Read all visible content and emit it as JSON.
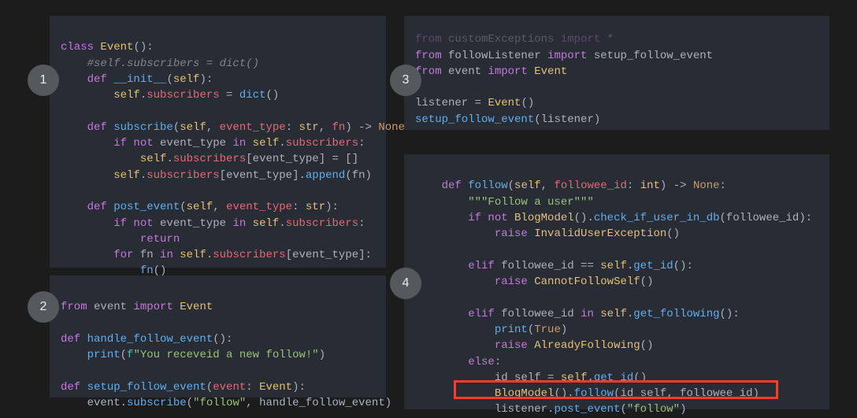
{
  "badges": {
    "b1": "1",
    "b2": "2",
    "b3": "3",
    "b4": "4"
  },
  "panel1": {
    "l1": {
      "a": "class ",
      "b": "Event",
      "c": "():"
    },
    "l2": {
      "a": "    #self.subscribers = dict()"
    },
    "l3": {
      "a": "    ",
      "b": "def ",
      "c": "__init__",
      "d": "(",
      "e": "self",
      "f": "):"
    },
    "l4": {
      "a": "        ",
      "b": "self",
      "c": ".",
      "d": "subscribers",
      "e": " = ",
      "f": "dict",
      "g": "()"
    },
    "l5": "",
    "l6": {
      "a": "    ",
      "b": "def ",
      "c": "subscribe",
      "d": "(",
      "e": "self",
      "f": ", ",
      "g": "event_type",
      "h": ": ",
      "i": "str",
      "j": ", ",
      "k": "fn",
      "l": ") -> ",
      "m": "None",
      "n": ":"
    },
    "l7": {
      "a": "        ",
      "b": "if not ",
      "c": "event_type",
      "d": " ",
      "e": "in ",
      "f": "self",
      "g": ".",
      "h": "subscribers",
      "i": ":"
    },
    "l8": {
      "a": "            ",
      "b": "self",
      "c": ".",
      "d": "subscribers",
      "e": "[",
      "f": "event_type",
      "g": "] = []"
    },
    "l9": {
      "a": "        ",
      "b": "self",
      "c": ".",
      "d": "subscribers",
      "e": "[",
      "f": "event_type",
      "g": "].",
      "h": "append",
      "i": "(",
      "j": "fn",
      "k": ")"
    },
    "l10": "",
    "l11": {
      "a": "    ",
      "b": "def ",
      "c": "post_event",
      "d": "(",
      "e": "self",
      "f": ", ",
      "g": "event_type",
      "h": ": ",
      "i": "str",
      "j": "):"
    },
    "l12": {
      "a": "        ",
      "b": "if not ",
      "c": "event_type",
      "d": " ",
      "e": "in ",
      "f": "self",
      "g": ".",
      "h": "subscribers",
      "i": ":"
    },
    "l13": {
      "a": "            ",
      "b": "return"
    },
    "l14": {
      "a": "        ",
      "b": "for ",
      "c": "fn",
      "d": " ",
      "e": "in ",
      "f": "self",
      "g": ".",
      "h": "subscribers",
      "i": "[",
      "j": "event_type",
      "k": "]:"
    },
    "l15": {
      "a": "            ",
      "b": "fn",
      "c": "()"
    }
  },
  "panel2": {
    "l1": {
      "a": "from ",
      "b": "event",
      "c": " import ",
      "d": "Event"
    },
    "l2": "",
    "l3": {
      "a": "def ",
      "b": "handle_follow_event",
      "c": "():"
    },
    "l4": {
      "a": "    ",
      "b": "print",
      "c": "(",
      "d": "f",
      "e": "\"You receveid a new follow!\"",
      "f": ")"
    },
    "l5": "",
    "l6": {
      "a": "def ",
      "b": "setup_follow_event",
      "c": "(",
      "d": "event",
      "e": ": ",
      "f": "Event",
      "g": "):"
    },
    "l7": {
      "a": "    ",
      "b": "event",
      "c": ".",
      "d": "subscribe",
      "e": "(",
      "f": "\"follow\"",
      "g": ", ",
      "h": "handle_follow_event",
      "i": ")"
    }
  },
  "panel3": {
    "l0": {
      "a": "from ",
      "b": "customExceptions",
      "c": " import ",
      "d": "*"
    },
    "l1": {
      "a": "from ",
      "b": "followListener",
      "c": " import ",
      "d": "setup_follow_event"
    },
    "l2": {
      "a": "from ",
      "b": "event",
      "c": " import ",
      "d": "Event"
    },
    "l3": "",
    "l4": {
      "a": "listener",
      "b": " = ",
      "c": "Event",
      "d": "()"
    },
    "l5": {
      "a": "setup_follow_event",
      "b": "(",
      "c": "listener",
      "d": ")"
    }
  },
  "panel4": {
    "l1": {
      "a": "    ",
      "b": "def ",
      "c": "follow",
      "d": "(",
      "e": "self",
      "f": ", ",
      "g": "followee_id",
      "h": ": ",
      "i": "int",
      "j": ") -> ",
      "k": "None",
      "l": ":"
    },
    "l2": {
      "a": "        ",
      "b": "\"\"\"Follow a user\"\"\""
    },
    "l3": {
      "a": "        ",
      "b": "if not ",
      "c": "BlogModel",
      "d": "().",
      "e": "check_if_user_in_db",
      "f": "(",
      "g": "followee_id",
      "h": "):"
    },
    "l4": {
      "a": "            ",
      "b": "raise ",
      "c": "InvalidUserException",
      "d": "()"
    },
    "l5": "",
    "l6": {
      "a": "        ",
      "b": "elif ",
      "c": "followee_id",
      "d": " == ",
      "e": "self",
      "f": ".",
      "g": "get_id",
      "h": "():"
    },
    "l7": {
      "a": "            ",
      "b": "raise ",
      "c": "CannotFollowSelf",
      "d": "()"
    },
    "l8": "",
    "l9": {
      "a": "        ",
      "b": "elif ",
      "c": "followee_id",
      "d": " ",
      "e": "in ",
      "f": "self",
      "g": ".",
      "h": "get_following",
      "i": "():"
    },
    "l10": {
      "a": "            ",
      "b": "print",
      "c": "(",
      "d": "True",
      "e": ")"
    },
    "l11": {
      "a": "            ",
      "b": "raise ",
      "c": "AlreadyFollowing",
      "d": "()"
    },
    "l12": {
      "a": "        ",
      "b": "else",
      "c": ":"
    },
    "l13": {
      "a": "            ",
      "b": "id_self",
      "c": " = ",
      "d": "self",
      "e": ".",
      "f": "get_id",
      "g": "()"
    },
    "l14": {
      "a": "            ",
      "b": "BlogModel",
      "c": "().",
      "d": "follow",
      "e": "(",
      "f": "id_self",
      "g": ", ",
      "h": "followee_id",
      "i": ")"
    },
    "l15": {
      "a": "            ",
      "b": "listener",
      "c": ".",
      "d": "post_event",
      "e": "(",
      "f": "\"follow\"",
      "g": ")"
    }
  }
}
